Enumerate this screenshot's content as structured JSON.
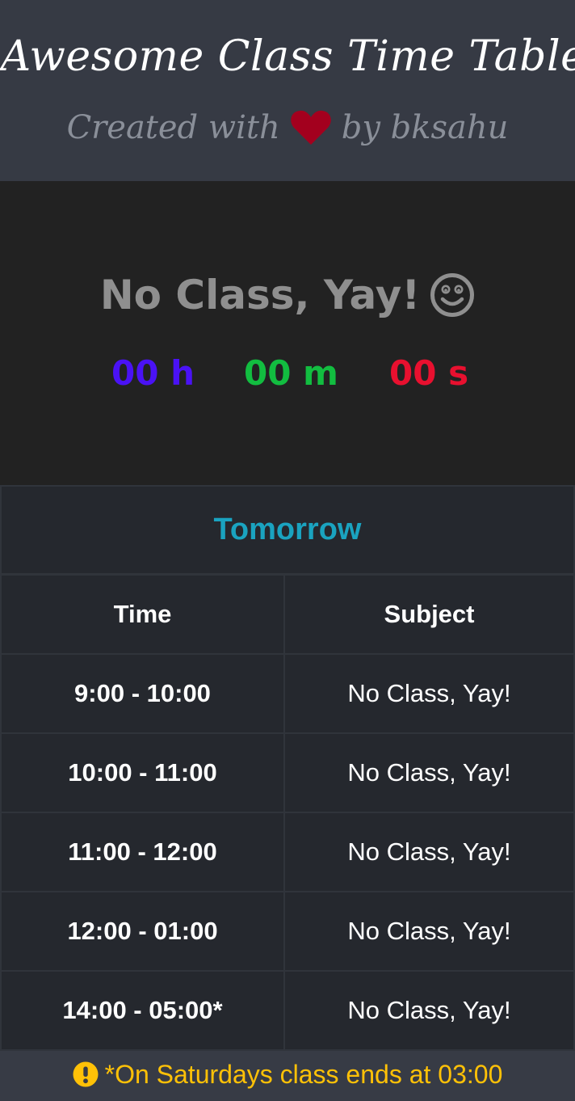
{
  "header": {
    "title": "Awesome Class Time Table",
    "credit_prefix": "Created with",
    "credit_suffix": "by bksahu",
    "icon_title": "graduation-cap-icon",
    "icon_credit": "heart-icon"
  },
  "status": {
    "message": "No Class, Yay!",
    "icon": "smile-icon",
    "countdown": {
      "hours": "00 h",
      "minutes": "00 m",
      "seconds": "00 s"
    }
  },
  "timetable": {
    "day": "Tomorrow",
    "columns": [
      "Time",
      "Subject"
    ],
    "rows": [
      {
        "time": "9:00 - 10:00",
        "subject": "No Class, Yay!"
      },
      {
        "time": "10:00 - 11:00",
        "subject": "No Class, Yay!"
      },
      {
        "time": "11:00 - 12:00",
        "subject": "No Class, Yay!"
      },
      {
        "time": "12:00 - 01:00",
        "subject": "No Class, Yay!"
      },
      {
        "time": "14:00 - 05:00*",
        "subject": "No Class, Yay!"
      }
    ]
  },
  "footer": {
    "note": "*On Saturdays class ends at 03:00",
    "icon": "exclamation-circle-icon"
  },
  "colors": {
    "header_bg": "#363a44",
    "panel_bg": "#222222",
    "table_bg": "#25282e",
    "day_accent": "#1aa3c0",
    "hours": "#4a12f5",
    "minutes": "#12bd40",
    "seconds": "#e8102f",
    "heart": "#a3001e",
    "warning": "#ffc107"
  }
}
